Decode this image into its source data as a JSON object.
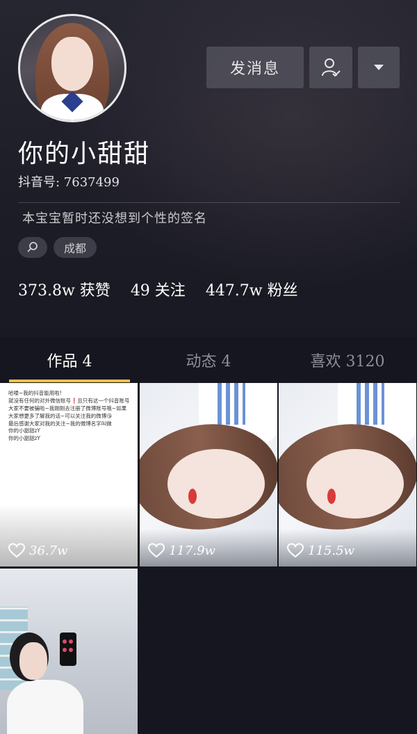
{
  "profile": {
    "nickname": "你的小甜甜",
    "douyin_id": "抖音号: 7637499",
    "signature": "本宝宝暂时还没想到个性的签名",
    "city": "成都"
  },
  "actions": {
    "message_label": "发消息"
  },
  "stats": {
    "likes": "373.8w 获赞",
    "following": "49 关注",
    "followers": "447.7w 粉丝"
  },
  "tabs": [
    {
      "label": "作品 4",
      "active": true
    },
    {
      "label": "动态 4",
      "active": false
    },
    {
      "label": "喜欢 3120",
      "active": false
    }
  ],
  "posts": [
    {
      "likes": "36.7w",
      "text": "哈喽~我的抖音能用啦!\n就没有任何的对外微信账号❗且只有这一个抖音账号\n大家不要被骗啦~我刚刚去注册了微博账号哦~如果大家想更多了解我的话~可以关注我的微博😘\n最后感谢大家对我的关注~我的微博名字叫做\n你的小甜甜zY\n你的小甜甜zY"
    },
    {
      "likes": "117.9w"
    },
    {
      "likes": "115.5w"
    },
    {
      "likes": ""
    }
  ],
  "colors": {
    "accent_underline": "#f5c242",
    "background": "#15161f"
  }
}
